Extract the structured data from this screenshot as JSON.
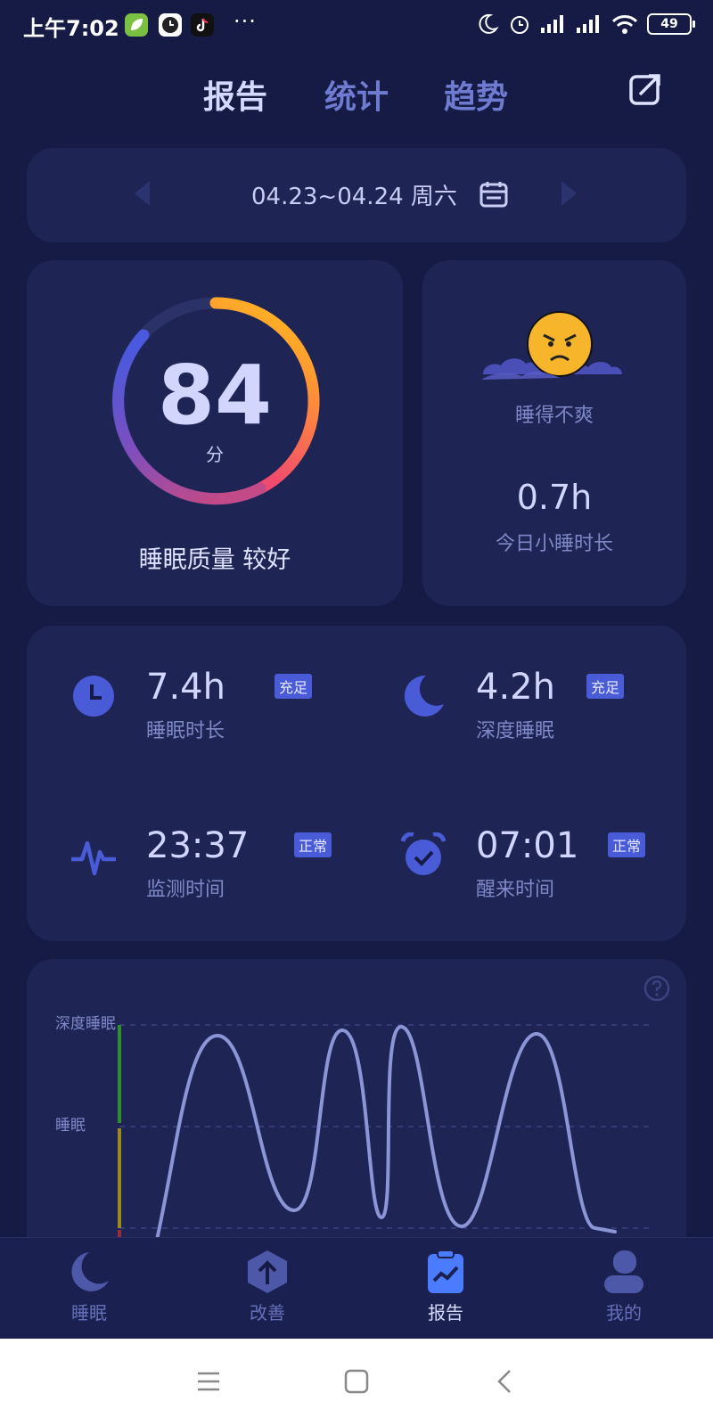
{
  "status_bar": {
    "time": "上午7:02",
    "dots": "···",
    "battery": "49"
  },
  "tabs": [
    {
      "label": "报告",
      "active": true
    },
    {
      "label": "统计",
      "active": false
    },
    {
      "label": "趋势",
      "active": false
    }
  ],
  "date_range": "04.23~04.24 周六",
  "score": {
    "value": "84",
    "unit": "分",
    "quality": "睡眠质量 较好"
  },
  "mood": {
    "text": "睡得不爽",
    "nap_value": "0.7h",
    "nap_label": "今日小睡时长"
  },
  "metrics": [
    {
      "value": "7.4h",
      "badge": "充足",
      "label": "睡眠时长",
      "icon": "clock-icon"
    },
    {
      "value": "4.2h",
      "badge": "充足",
      "label": "深度睡眠",
      "icon": "moon-icon"
    },
    {
      "value": "23:37",
      "badge": "正常",
      "label": "监测时间",
      "icon": "heartbeat-icon"
    },
    {
      "value": "07:01",
      "badge": "正常",
      "label": "醒来时间",
      "icon": "alarm-clock-icon"
    }
  ],
  "chart": {
    "stage_labels": [
      "深度睡眠",
      "睡眠"
    ]
  },
  "bottom_nav": [
    {
      "label": "睡眠",
      "icon": "moon-icon",
      "active": false
    },
    {
      "label": "改善",
      "icon": "improve-icon",
      "active": false
    },
    {
      "label": "报告",
      "icon": "report-icon",
      "active": true
    },
    {
      "label": "我的",
      "icon": "profile-icon",
      "active": false
    }
  ],
  "colors": {
    "background": "#151b45",
    "card": "#1e2554",
    "accent": "#4a5bd8",
    "stage_deep": "#2f8f2c",
    "stage_sleep": "#9e8a1c"
  }
}
